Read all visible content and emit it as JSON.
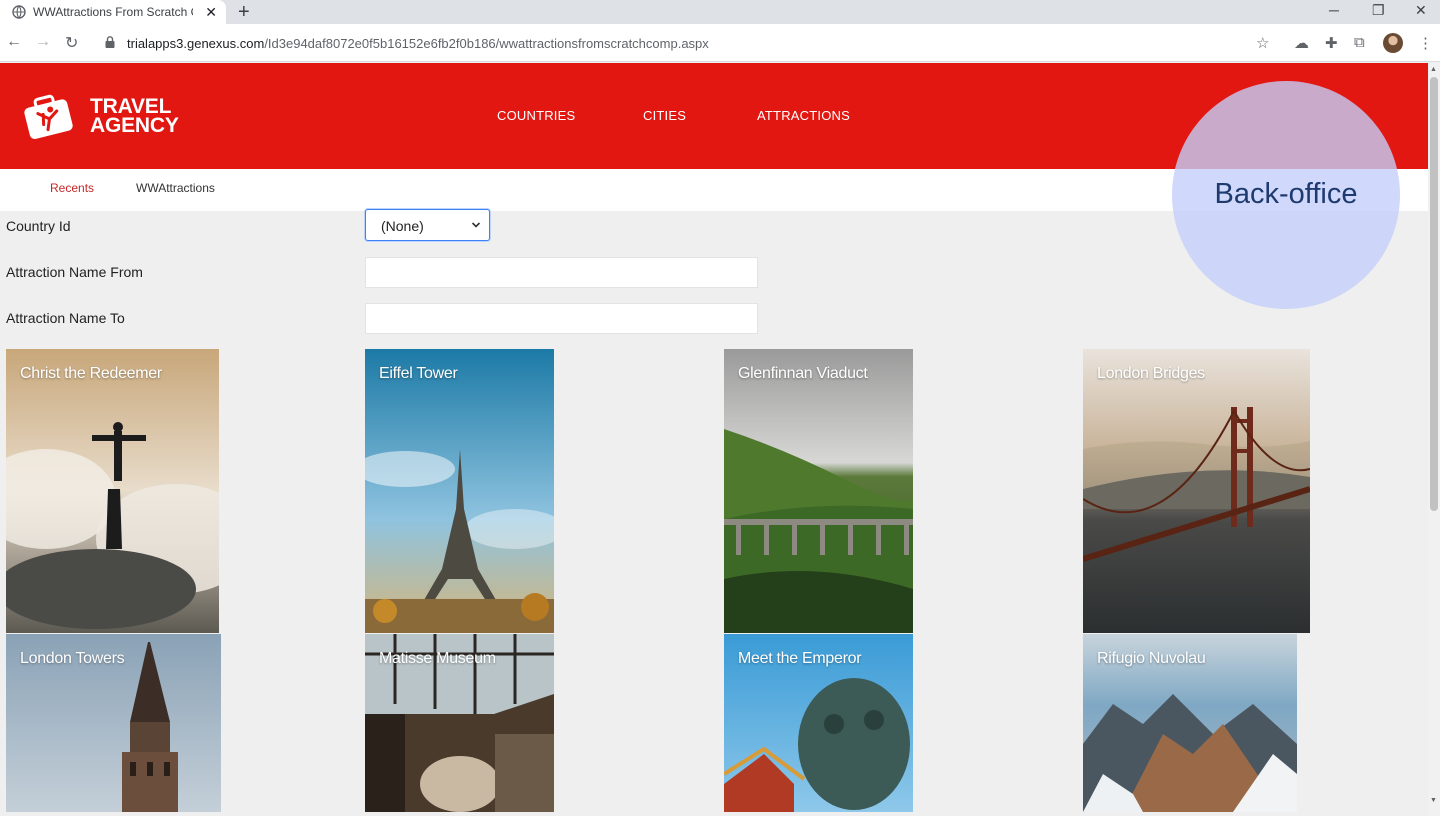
{
  "browser": {
    "tab_title": "WWAttractions From Scratch Com",
    "url_host": "trialapps3.genexus.com",
    "url_path": "/Id3e94daf8072e0f5b16152e6fb2f0b186/wwattractionsfromscratchcomp.aspx"
  },
  "header": {
    "brand_line1": "TRAVEL",
    "brand_line2": "AGENCY",
    "menu": [
      "COUNTRIES",
      "CITIES",
      "ATTRACTIONS"
    ],
    "brand_color": "#e21711"
  },
  "breadcrumb": {
    "recents": "Recents",
    "current": "WWAttractions"
  },
  "filters": {
    "country_label": "Country Id",
    "country_value": "(None)",
    "name_from_label": "Attraction Name From",
    "name_from_value": "",
    "name_to_label": "Attraction Name To",
    "name_to_value": ""
  },
  "attractions": [
    "Christ the Redeemer",
    "Eiffel Tower",
    "Glenfinnan Viaduct",
    "London Bridges",
    "London Towers",
    "Matisse Museum",
    "Meet the Emperor",
    "Rifugio Nuvolau"
  ],
  "overlay": {
    "label": "Back-office"
  }
}
